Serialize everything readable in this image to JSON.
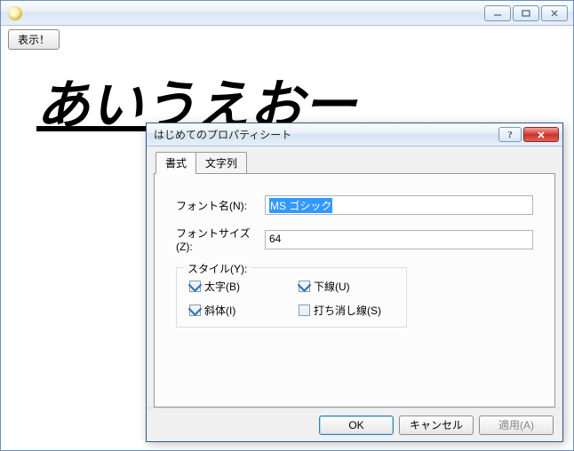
{
  "main_window": {
    "display_button": "表示！",
    "canvas_text": "あいうえおー"
  },
  "dialog": {
    "title": "はじめてのプロパティシート",
    "help_symbol": "?",
    "tabs": {
      "format": "書式",
      "string": "文字列"
    },
    "fields": {
      "font_name_label": "フォント名(N):",
      "font_name_value": "MS ゴシック",
      "font_size_label": "フォントサイズ(Z):",
      "font_size_value": "64"
    },
    "style_group": {
      "title": "スタイル(Y):",
      "bold": {
        "label": "太字(B)",
        "checked": true
      },
      "underline": {
        "label": "下線(U)",
        "checked": true
      },
      "italic": {
        "label": "斜体(I)",
        "checked": true
      },
      "strikeout": {
        "label": "打ち消し線(S)",
        "checked": false
      }
    },
    "buttons": {
      "ok": "OK",
      "cancel": "キャンセル",
      "apply": "適用(A)"
    }
  }
}
